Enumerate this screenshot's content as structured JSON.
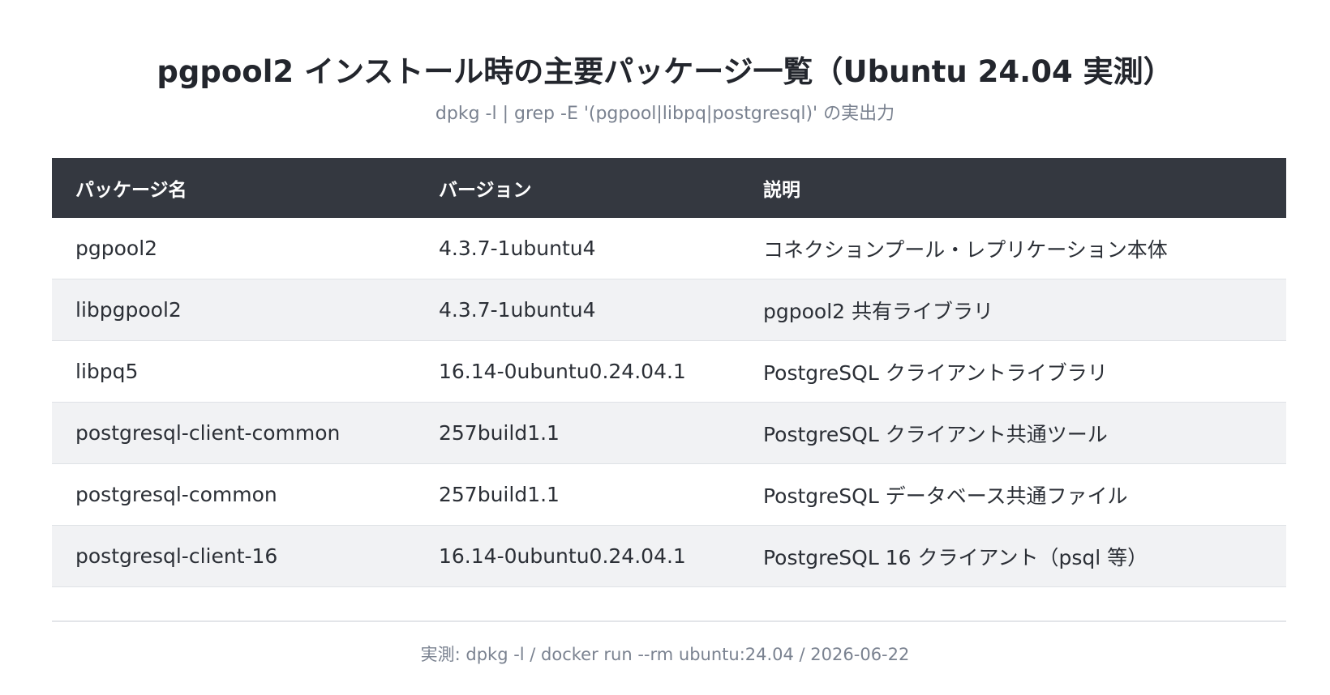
{
  "title": "pgpool2 インストール時の主要パッケージ一覧（Ubuntu 24.04 実測）",
  "subtitle": "dpkg -l | grep -E '(pgpool|libpq|postgresql)' の実出力",
  "table": {
    "headers": [
      "パッケージ名",
      "バージョン",
      "説明"
    ],
    "rows": [
      [
        "pgpool2",
        "4.3.7-1ubuntu4",
        "コネクションプール・レプリケーション本体"
      ],
      [
        "libpgpool2",
        "4.3.7-1ubuntu4",
        "pgpool2 共有ライブラリ"
      ],
      [
        "libpq5",
        "16.14-0ubuntu0.24.04.1",
        "PostgreSQL クライアントライブラリ"
      ],
      [
        "postgresql-client-common",
        "257build1.1",
        "PostgreSQL クライアント共通ツール"
      ],
      [
        "postgresql-common",
        "257build1.1",
        "PostgreSQL データベース共通ファイル"
      ],
      [
        "postgresql-client-16",
        "16.14-0ubuntu0.24.04.1",
        "PostgreSQL 16 クライアント（psql 等）"
      ]
    ]
  },
  "footer": "実測: dpkg -l / docker run --rm ubuntu:24.04 / 2026-06-22",
  "colors": {
    "header_bg": "#343840",
    "alt_row_bg": "#f1f2f4",
    "muted_text": "#7a8290"
  }
}
